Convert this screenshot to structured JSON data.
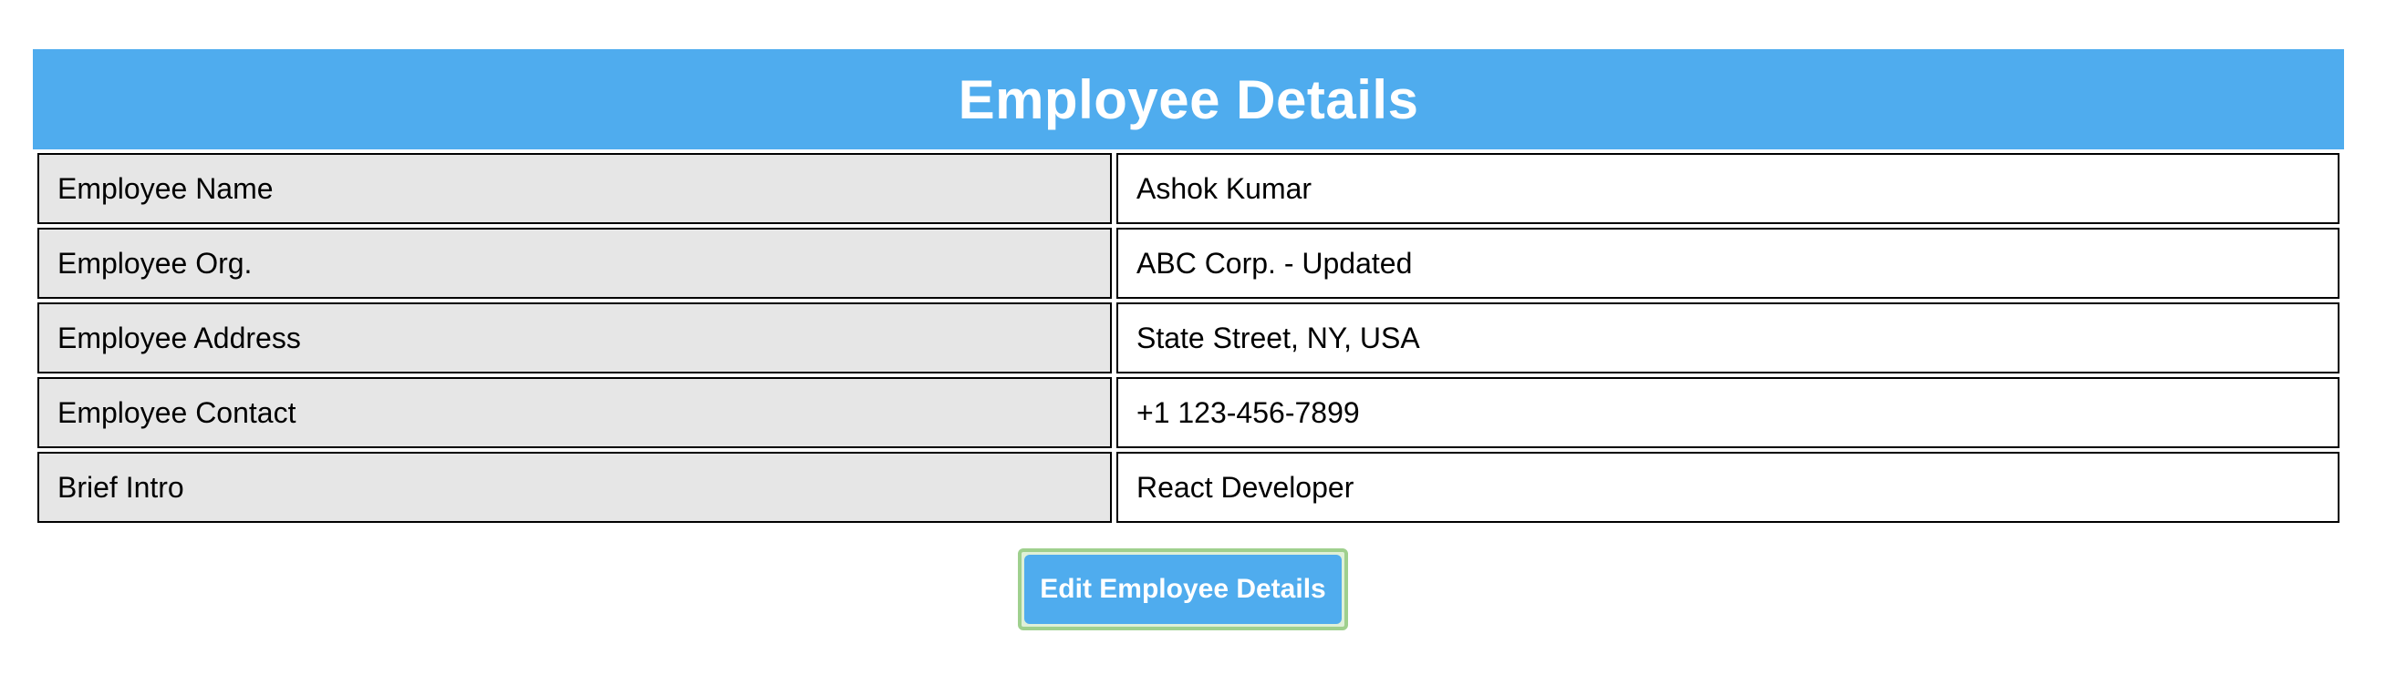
{
  "header": {
    "title": "Employee Details"
  },
  "rows": [
    {
      "label": "Employee Name",
      "value": "Ashok Kumar"
    },
    {
      "label": "Employee Org.",
      "value": "ABC Corp. - Updated"
    },
    {
      "label": "Employee Address",
      "value": "State Street, NY, USA"
    },
    {
      "label": "Employee Contact",
      "value": "+1 123-456-7899"
    },
    {
      "label": "Brief Intro",
      "value": "React Developer"
    }
  ],
  "actions": {
    "edit_label": "Edit Employee Details"
  },
  "colors": {
    "header_bg": "#4facee",
    "label_bg": "#e6e6e6",
    "button_bg": "#4facee",
    "focus_ring": "#9fd08e"
  }
}
